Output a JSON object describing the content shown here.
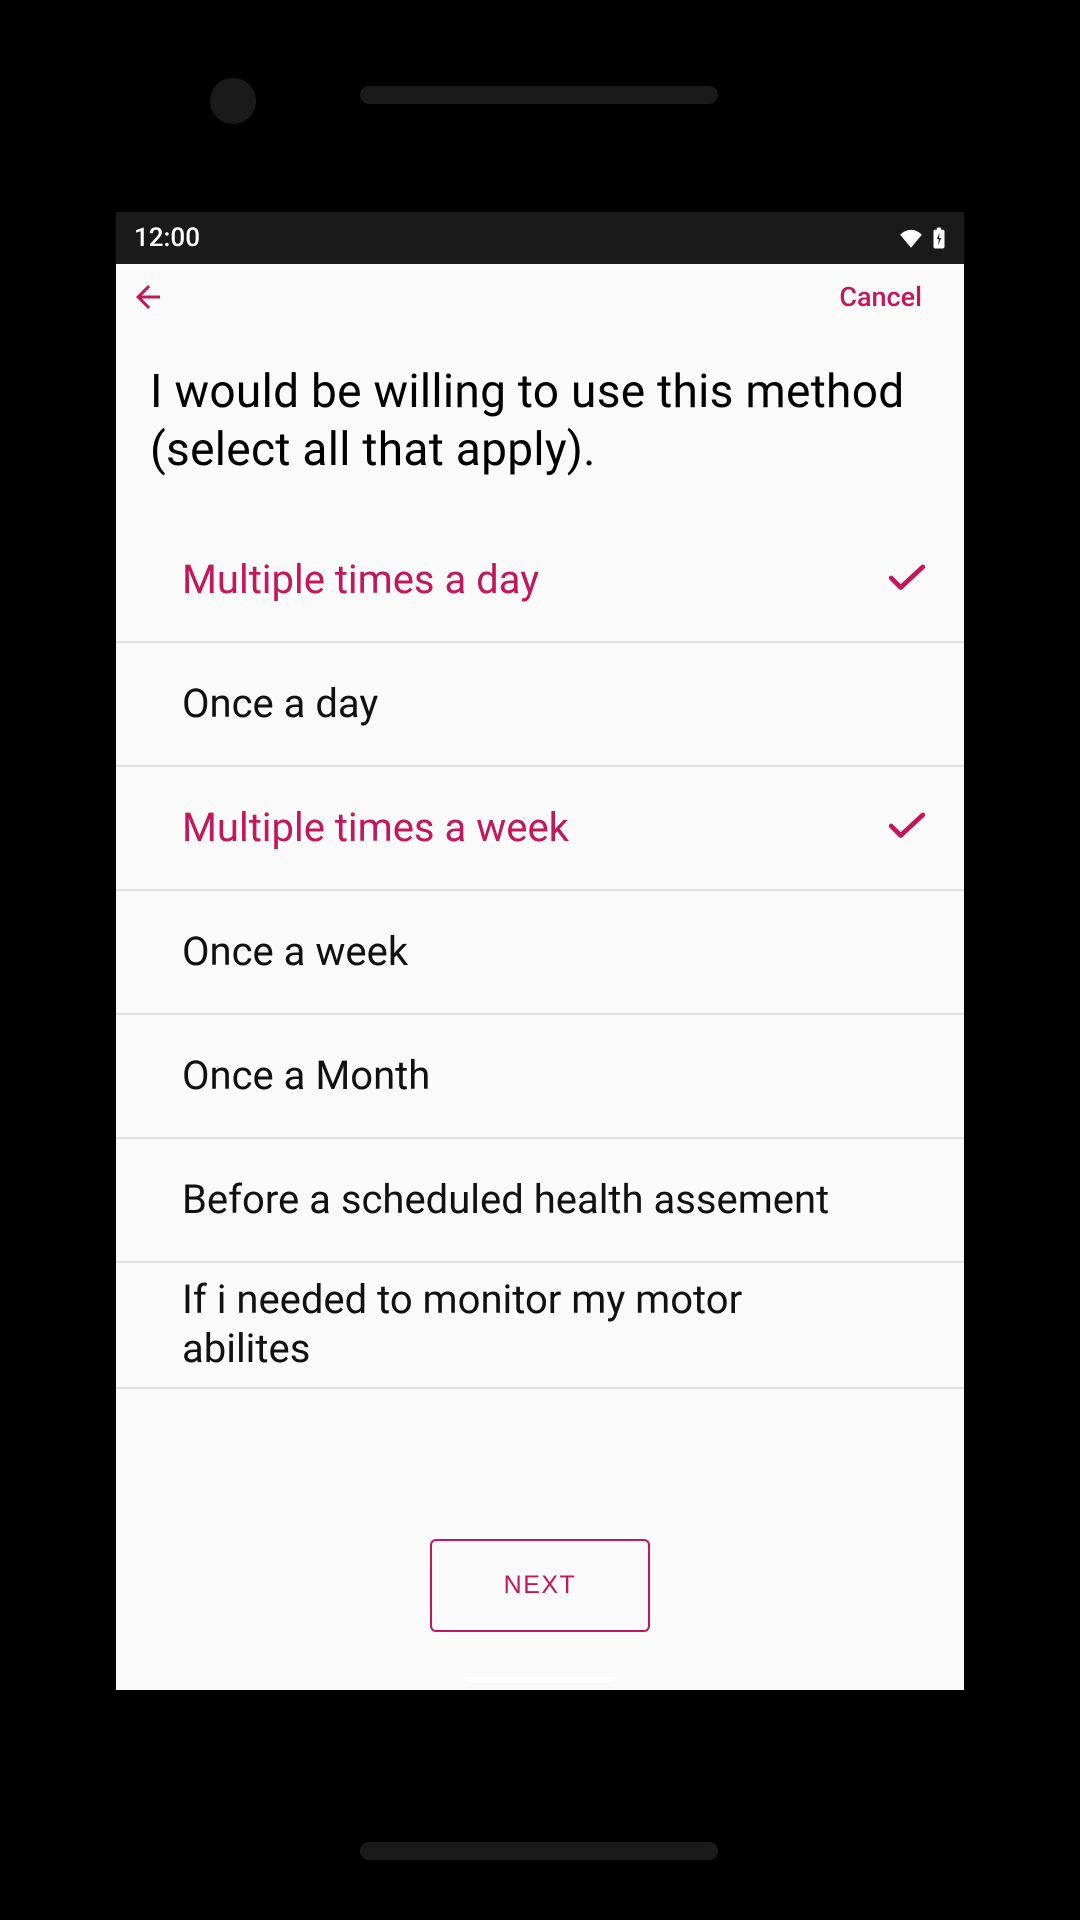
{
  "status": {
    "time": "12:00"
  },
  "header": {
    "cancel": "Cancel"
  },
  "question": "I would be willing to use this method (select all that apply).",
  "options": [
    {
      "label": "Multiple times a day",
      "selected": true
    },
    {
      "label": "Once a day",
      "selected": false
    },
    {
      "label": "Multiple times a week",
      "selected": true
    },
    {
      "label": "Once a week",
      "selected": false
    },
    {
      "label": "Once a Month",
      "selected": false
    },
    {
      "label": "Before a scheduled health assement",
      "selected": false
    },
    {
      "label": "If i needed to monitor my motor abilites",
      "selected": false
    }
  ],
  "buttons": {
    "next": "NEXT"
  },
  "colors": {
    "accent": "#c2185b"
  }
}
